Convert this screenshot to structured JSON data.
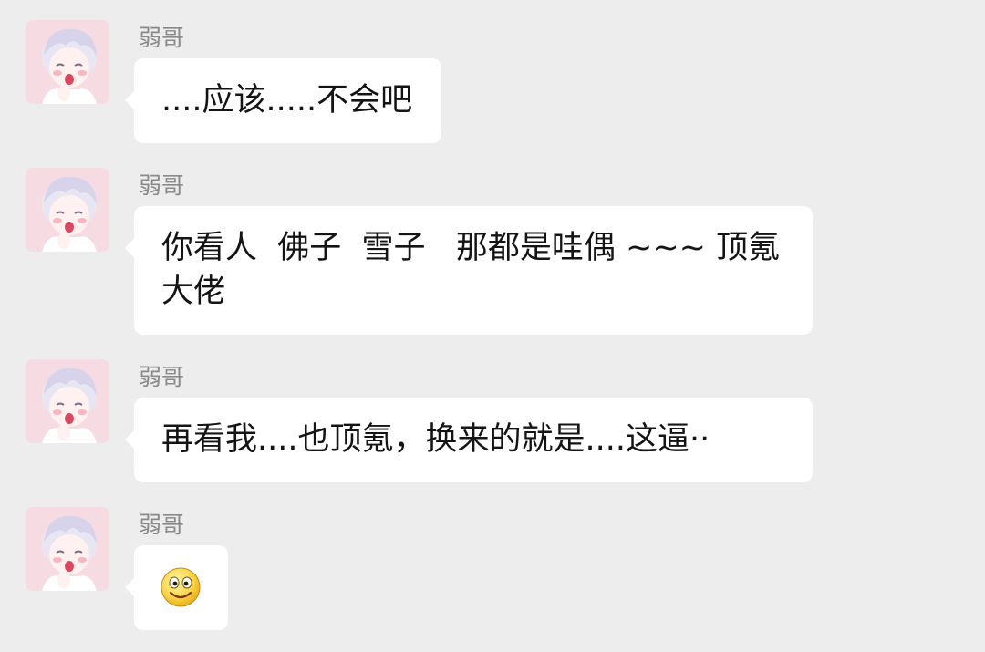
{
  "colors": {
    "background": "#ededed",
    "bubble": "#ffffff",
    "sender_name": "#8a8a8a",
    "message_text": "#141414",
    "avatar_bg": "#f7dbe3"
  },
  "messages": [
    {
      "sender": "弱哥",
      "avatar_icon": "anime-avatar-icon",
      "text": "....应该.....不会吧"
    },
    {
      "sender": "弱哥",
      "avatar_icon": "anime-avatar-icon",
      "text": "你看人  佛子  雪子   那都是哇偶 ~~~ 顶氪大佬"
    },
    {
      "sender": "弱哥",
      "avatar_icon": "anime-avatar-icon",
      "text": "再看我....也顶氪，换来的就是....这逼··"
    },
    {
      "sender": "弱哥",
      "avatar_icon": "anime-avatar-icon",
      "emoji": "smiley-emoji-icon"
    }
  ]
}
